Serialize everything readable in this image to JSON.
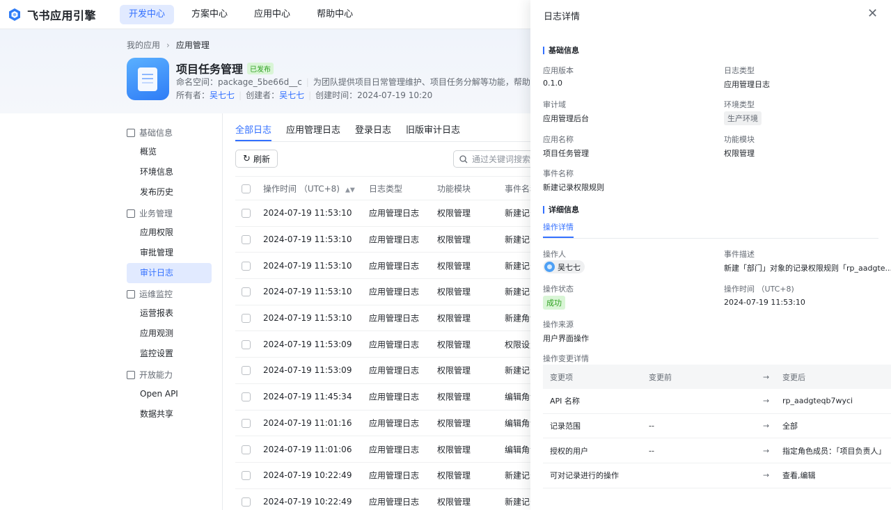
{
  "brand": {
    "name": "飞书应用引擎",
    "logo_icon": "feishu-logo-icon"
  },
  "nav": [
    "开发中心",
    "方案中心",
    "应用中心",
    "帮助中心"
  ],
  "breadcrumb": {
    "root": "我的应用",
    "current": "应用管理"
  },
  "app": {
    "name": "项目任务管理",
    "status": "已发布",
    "namespace_label": "命名空间：",
    "namespace": "package_5be66d__c",
    "description": "为团队提供项目日常管理维护、项目任务分解等功能，帮助团队实时掌握",
    "owner_label": "所有者：",
    "owner": "吴七七",
    "creator_label": "创建者：",
    "creator": "吴七七",
    "created_label": "创建时间：",
    "created": "2024-07-19 10:20"
  },
  "sidebar": {
    "groups": [
      {
        "label": "基础信息",
        "icon": "doc-icon",
        "items": [
          "概览",
          "环境信息",
          "发布历史"
        ]
      },
      {
        "label": "业务管理",
        "icon": "briefcase-icon",
        "items": [
          "应用权限",
          "审批管理",
          "审计日志"
        ]
      },
      {
        "label": "运维监控",
        "icon": "monitor-icon",
        "items": [
          "运营报表",
          "应用观测",
          "监控设置"
        ]
      },
      {
        "label": "开放能力",
        "icon": "layers-icon",
        "items": [
          "Open API",
          "数据共享"
        ]
      }
    ],
    "active": "审计日志"
  },
  "tabs": [
    "全部日志",
    "应用管理日志",
    "登录日志",
    "旧版审计日志"
  ],
  "toolbar": {
    "refresh": "刷新",
    "search_placeholder": "通过关键词搜索"
  },
  "table": {
    "headers": {
      "time": "操作时间 （UTC+8)",
      "type": "日志类型",
      "module": "功能模块",
      "event": "事件名称"
    },
    "rows": [
      {
        "time": "2024-07-19 11:53:10",
        "type": "应用管理日志",
        "module": "权限管理",
        "event": "新建记录"
      },
      {
        "time": "2024-07-19 11:53:10",
        "type": "应用管理日志",
        "module": "权限管理",
        "event": "新建记录"
      },
      {
        "time": "2024-07-19 11:53:10",
        "type": "应用管理日志",
        "module": "权限管理",
        "event": "新建记录"
      },
      {
        "time": "2024-07-19 11:53:10",
        "type": "应用管理日志",
        "module": "权限管理",
        "event": "新建记录"
      },
      {
        "time": "2024-07-19 11:53:10",
        "type": "应用管理日志",
        "module": "权限管理",
        "event": "新建角色"
      },
      {
        "time": "2024-07-19 11:53:09",
        "type": "应用管理日志",
        "module": "权限管理",
        "event": "权限设置"
      },
      {
        "time": "2024-07-19 11:53:09",
        "type": "应用管理日志",
        "module": "权限管理",
        "event": "新建记录"
      },
      {
        "time": "2024-07-19 11:45:34",
        "type": "应用管理日志",
        "module": "权限管理",
        "event": "编辑角色"
      },
      {
        "time": "2024-07-19 11:01:16",
        "type": "应用管理日志",
        "module": "权限管理",
        "event": "编辑角色"
      },
      {
        "time": "2024-07-19 11:01:06",
        "type": "应用管理日志",
        "module": "权限管理",
        "event": "编辑角色"
      },
      {
        "time": "2024-07-19 10:22:49",
        "type": "应用管理日志",
        "module": "权限管理",
        "event": "新建记录"
      },
      {
        "time": "2024-07-19 10:22:49",
        "type": "应用管理日志",
        "module": "权限管理",
        "event": "新建记录"
      }
    ]
  },
  "drawer": {
    "title": "日志详情",
    "basic_title": "基础信息",
    "fields": {
      "app_version": {
        "label": "应用版本",
        "value": "0.1.0"
      },
      "log_type": {
        "label": "日志类型",
        "value": "应用管理日志"
      },
      "audit_domain": {
        "label": "审计域",
        "value": "应用管理后台"
      },
      "env_type": {
        "label": "环境类型",
        "value": "生产环境"
      },
      "app_name": {
        "label": "应用名称",
        "value": "项目任务管理"
      },
      "func_module": {
        "label": "功能模块",
        "value": "权限管理"
      },
      "event_name": {
        "label": "事件名称",
        "value": "新建记录权限规则"
      }
    },
    "detail_title": "详细信息",
    "detail_tab": "操作详情",
    "operator": {
      "label": "操作人",
      "value": "吴七七"
    },
    "event_desc": {
      "label": "事件描述",
      "value": "新建「部门」对象的记录权限规则「rp_aadgte..."
    },
    "op_status": {
      "label": "操作状态",
      "value": "成功"
    },
    "op_time": {
      "label": "操作时间 （UTC+8)",
      "value": "2024-07-19 11:53:10"
    },
    "op_source": {
      "label": "操作来源",
      "value": "用户界面操作"
    },
    "changes_title": "操作变更详情",
    "changes_headers": {
      "item": "变更项",
      "before": "变更前",
      "arrow": "→",
      "after": "变更后"
    },
    "changes": [
      {
        "item": "API 名称",
        "before": "",
        "arrow": "→",
        "after": "rp_aadgteqb7wyci"
      },
      {
        "item": "记录范围",
        "before": "--",
        "arrow": "→",
        "after": "全部"
      },
      {
        "item": "授权的用户",
        "before": "--",
        "arrow": "→",
        "after": "指定角色成员：「项目负责人」"
      },
      {
        "item": "可对记录进行的操作",
        "before": "",
        "arrow": "→",
        "after": "查看,编辑"
      }
    ]
  }
}
